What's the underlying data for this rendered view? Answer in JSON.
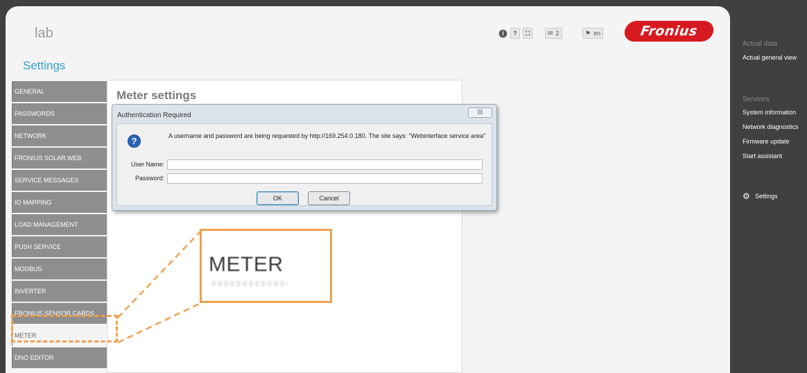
{
  "header": {
    "site_name": "lab",
    "toolbar": {
      "info_label": "i",
      "help_label": "?",
      "fullscreen_label": "⛶",
      "messages_count": "2",
      "language": "en"
    },
    "logo_text": "Fronius"
  },
  "settings_title": "Settings",
  "sidebar": {
    "items": [
      {
        "label": "GENERAL"
      },
      {
        "label": "PASSWORDS"
      },
      {
        "label": "NETWORK"
      },
      {
        "label": "FRONIUS SOLAR.WEB"
      },
      {
        "label": "SERVICE MESSAGES"
      },
      {
        "label": "IO MAPPING"
      },
      {
        "label": "LOAD MANAGEMENT"
      },
      {
        "label": "PUSH SERVICE"
      },
      {
        "label": "MODBUS"
      },
      {
        "label": "INVERTER"
      },
      {
        "label": "FRONIUS SENSOR CARDS"
      },
      {
        "label": "METER"
      },
      {
        "label": "DNO EDITOR"
      }
    ]
  },
  "content": {
    "title": "Meter settings"
  },
  "dialog": {
    "title": "Authentication Required",
    "close_label": "☒",
    "message": "A username and password are being requested by http://169.254.0.180. The site says: \"Webinterface service area\"",
    "username_label": "User Name:",
    "username_value": "",
    "password_label": "Password:",
    "password_value": "",
    "ok_label": "OK",
    "cancel_label": "Cancel"
  },
  "zoom_callout": {
    "text": "METER"
  },
  "right_panel": {
    "actual_data_heading": "Actual data",
    "actual_general_view": "Actual general view",
    "services_heading": "Services",
    "system_information": "System information",
    "network_diagnostics": "Network diagnostics",
    "firmware_update": "Firmware update",
    "start_assistant": "Start assistant",
    "settings": "Settings"
  },
  "colors": {
    "accent": "#2f9fd1",
    "brand": "#d71920",
    "highlight": "#f0a050",
    "sidebar": "#8e8e8e",
    "dark_panel": "#404040"
  }
}
